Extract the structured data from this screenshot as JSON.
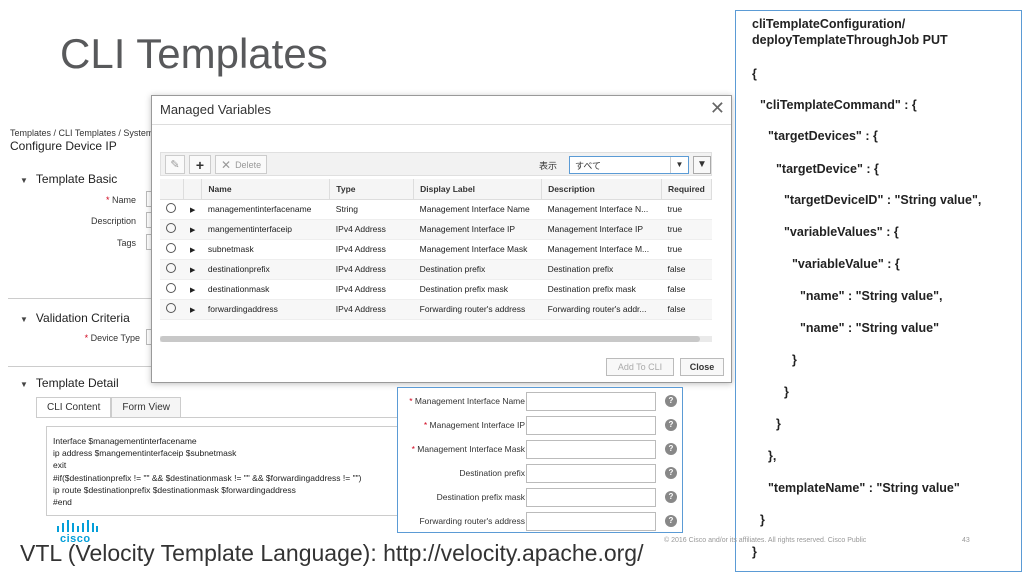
{
  "slide": {
    "title": "CLI Templates",
    "footer": "VTL (Velocity Template Language): http://velocity.apache.org/",
    "copyright": "© 2016  Cisco and/or its affiliates. All rights reserved.   Cisco Public",
    "page_number": "43",
    "logo_text": "cisco"
  },
  "configure_page": {
    "breadcrumb": "Templates / CLI Templates / System",
    "heading": "Configure Device IP",
    "sections": {
      "basic": "Template Basic",
      "validation": "Validation Criteria",
      "detail": "Template Detail"
    },
    "fields": {
      "name": "Name",
      "description": "Description",
      "tags": "Tags",
      "device_type": "Device Type"
    },
    "tabs": [
      "CLI Content",
      "Form View"
    ],
    "cli_content": "Interface $managementinterfacename\nip address $mangementinterfaceip $subnetmask\nexit\n#if($destinationprefix != \"\" && $destinationmask != \"\" && $forwardingaddress != \"\")\nip route $destinationprefix $destinationmask $forwardingaddress\n#end"
  },
  "modal": {
    "title": "Managed Variables",
    "close_glyph": "✕",
    "toolbar": {
      "edit_glyph": "✎",
      "add_glyph": "+",
      "delete_label": "Delete",
      "show_label": "表示",
      "filter_value": "すべて",
      "filter_glyph": "▼"
    },
    "columns": [
      "Name",
      "Type",
      "Display Label",
      "Description",
      "Required"
    ],
    "rows": [
      [
        "managementinterfacename",
        "String",
        "Management Interface Name",
        "Management Interface N...",
        "true"
      ],
      [
        "mangementinterfaceip",
        "IPv4 Address",
        "Management Interface IP",
        "Management Interface IP",
        "true"
      ],
      [
        "subnetmask",
        "IPv4 Address",
        "Management Interface Mask",
        "Management Interface M...",
        "true"
      ],
      [
        "destinationprefix",
        "IPv4 Address",
        "Destination prefix",
        "Destination prefix",
        "false"
      ],
      [
        "destinationmask",
        "IPv4 Address",
        "Destination prefix mask",
        "Destination prefix mask",
        "false"
      ],
      [
        "forwardingaddress",
        "IPv4 Address",
        "Forwarding router's address",
        "Forwarding router's addr...",
        "false"
      ]
    ],
    "buttons": {
      "add_to_cli": "Add To CLI",
      "close": "Close"
    }
  },
  "form_view": {
    "fields": [
      {
        "label": "Management Interface Name",
        "required": true
      },
      {
        "label": "Management Interface IP",
        "required": true
      },
      {
        "label": "Management Interface Mask",
        "required": true
      },
      {
        "label": "Destination prefix",
        "required": false
      },
      {
        "label": "Destination prefix mask",
        "required": false
      },
      {
        "label": "Forwarding router's address",
        "required": false
      }
    ]
  },
  "json_panel": {
    "lines": [
      "cliTemplateConfiguration/",
      "deployTemplateThroughJob PUT",
      "{",
      "\"cliTemplateCommand\" : {",
      "\"targetDevices\" : {",
      "\"targetDevice\" : {",
      "\"targetDeviceID\" : \"String value\",",
      "\"variableValues\" : {",
      "\"variableValue\" : {",
      "\"name\" : \"String value\",",
      "\"name\" : \"String value\"",
      "}",
      "}",
      "}",
      "},",
      "\"templateName\" : \"String value\"",
      "}",
      "}"
    ]
  }
}
